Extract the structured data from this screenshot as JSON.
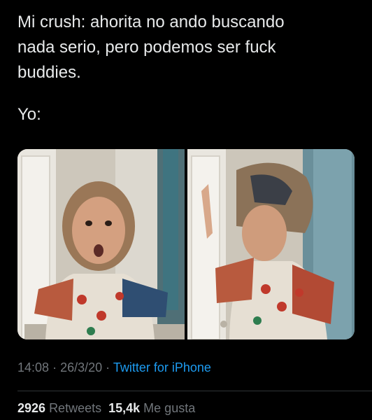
{
  "tweet": {
    "text_line_1": "Mi crush: ahorita no ando buscando\nnada serio, pero podemos ser fuck\nbuddies.",
    "text_line_2": "Yo:",
    "media": [
      {
        "kind": "photo"
      },
      {
        "kind": "photo"
      }
    ],
    "time": "14:08",
    "dot": "·",
    "date": "26/3/20",
    "source": "Twitter for iPhone",
    "retweets_count": "2926",
    "retweets_label": "Retweets",
    "likes_count": "15,4k",
    "likes_label": "Me gusta"
  },
  "colors": {
    "background": "#000000",
    "text": "#e7e9ea",
    "muted": "#71767b",
    "link": "#1d9bf0",
    "divider": "#2f3336"
  }
}
